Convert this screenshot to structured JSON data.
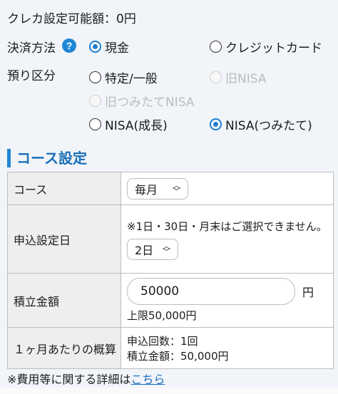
{
  "credit_limit": "クレカ設定可能額：0円",
  "payment": {
    "label": "決済方法",
    "help_icon": "?",
    "options": [
      {
        "label": "現金",
        "checked": true,
        "disabled": false
      },
      {
        "label": "クレジットカード",
        "checked": false,
        "disabled": false
      }
    ]
  },
  "account_type": {
    "label": "預り区分",
    "options": [
      {
        "label": "特定/一般",
        "checked": false,
        "disabled": false
      },
      {
        "label": "旧NISA",
        "checked": false,
        "disabled": true
      },
      {
        "label": "旧つみたてNISA",
        "checked": false,
        "disabled": true
      },
      {
        "label": "NISA(成長)",
        "checked": false,
        "disabled": false
      },
      {
        "label": "NISA(つみたて)",
        "checked": true,
        "disabled": false
      }
    ]
  },
  "course_settings": {
    "heading": "コース設定",
    "rows": {
      "course": {
        "label": "コース",
        "select_value": "毎月"
      },
      "apply_date": {
        "label": "申込設定日",
        "note": "※1日・30日・月末はご選択できません。",
        "select_value": "2日"
      },
      "amount": {
        "label": "積立金額",
        "input_value": "50000",
        "unit": "円",
        "limit": "上限50,000円"
      },
      "monthly": {
        "label": "１ヶ月あたりの概算",
        "count": "申込回数：1回",
        "total": "積立金額：50,000円"
      }
    }
  },
  "footer": {
    "text": "※費用等に関する詳細は",
    "link": "こちら"
  },
  "colors": {
    "accent": "#1f86d6",
    "heading": "#1b6fb8",
    "link": "#1f6fc2",
    "background": "#f1f4f8"
  }
}
